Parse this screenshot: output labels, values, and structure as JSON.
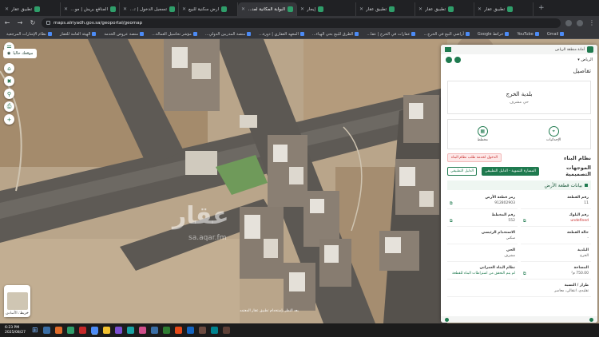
{
  "browser": {
    "tabs": [
      {
        "title": "تطبيق عقار",
        "active": false
      },
      {
        "title": "المنافع بريش | موقع حراج",
        "active": false
      },
      {
        "title": "تسجيل الدخول | تطبيق عقار",
        "active": false
      },
      {
        "title": "أرض سكنية للبيع",
        "active": false
      },
      {
        "title": "البوابة المكانية لمنطقة الرياض",
        "active": true
      },
      {
        "title": "إيجار",
        "active": false
      },
      {
        "title": "تطبيق عقار",
        "active": false
      },
      {
        "title": "تطبيق عقار",
        "active": false
      },
      {
        "title": "تطبيق عقار",
        "active": false
      }
    ],
    "new_tab": "+",
    "url": "maps.alriyadh.gov.sa/geoportal/geomap",
    "bookmarks": [
      "Gmail",
      "YouTube",
      "خرائط Google",
      "أراضي البيع في الخرج...",
      "عقارات في الخرج | عقا...",
      "الطرق للبيع بحي الهياء...",
      "المعهد العقاري | دورة...",
      "منصة المدربين الدولي...",
      "مؤشر تحاسيل العمالة...",
      "منصة عروض الخدمة",
      "الهيئة العامة للعقار",
      "نظام الإشارات المرجعية"
    ]
  },
  "map": {
    "top_chip": "موقعك حاليا",
    "minimap_label": "خريطة الأساس",
    "scale": "30 m",
    "watermark": "عقار",
    "watermark_sub": "sa.aqar.fm",
    "attribution": "بعد النظر بإستخدام تطبيق عقار المعتمد"
  },
  "panel": {
    "org": "أمانة منطقة الرياض",
    "region": "الرياض",
    "title": "تفاصيل",
    "district_name": "بلدية الخرج",
    "district_type": "حي مشرف",
    "actions": [
      "الإحداثيات",
      "مخطط"
    ],
    "building_system_title": "نظام البناء",
    "building_alert": "الدخول لخدمة طلب نظام البناء",
    "directions_title": "الموجهات التصميمية",
    "directions_tabs": [
      "المسارة التنموية - الدليل التطبيقي",
      "الدليل التطبيقي"
    ],
    "parcel_section_title": "بيانات قطعة الأرض",
    "fields": [
      {
        "key": "رقم القطعة",
        "value": "11"
      },
      {
        "key": "رمز قطعة الأرض",
        "value": "912802903"
      },
      {
        "key": "رقم البلوك",
        "value": "undefined"
      },
      {
        "key": "رقم المخطط",
        "value": "552"
      },
      {
        "key": "حالة القطعة",
        "value": "-"
      },
      {
        "key": "الاستخدام الرئيسي",
        "value": "سكني"
      },
      {
        "key": "البلدية",
        "value": "الخرج"
      },
      {
        "key": "الحي",
        "value": "مشرف"
      },
      {
        "key": "المساحة",
        "value": "750.00 م²"
      },
      {
        "key": "نظام البناء العمراني",
        "value": "لم يتم التحقق من اشتراطات البناء للقطعة"
      },
      {
        "key": "طراز / النسبة",
        "value": "تقليدي، انتقالي، معاصر"
      }
    ]
  },
  "taskbar": {
    "time": "6:23 PM",
    "date": "2025/08/27",
    "apps": [
      "#3a6ea5",
      "#e06c2a",
      "#2f9e6a",
      "#c62828",
      "#4c8bf5",
      "#f2c230",
      "#7b4fd1",
      "#1aa3a3",
      "#d14f8b",
      "#3a6ea5",
      "#2e7d32",
      "#e64a19",
      "#1565c0",
      "#6d4c41",
      "#00838f",
      "#5d4037"
    ]
  },
  "colors": {
    "brand_green": "#1f7a4f",
    "alert_red": "#c62828"
  }
}
